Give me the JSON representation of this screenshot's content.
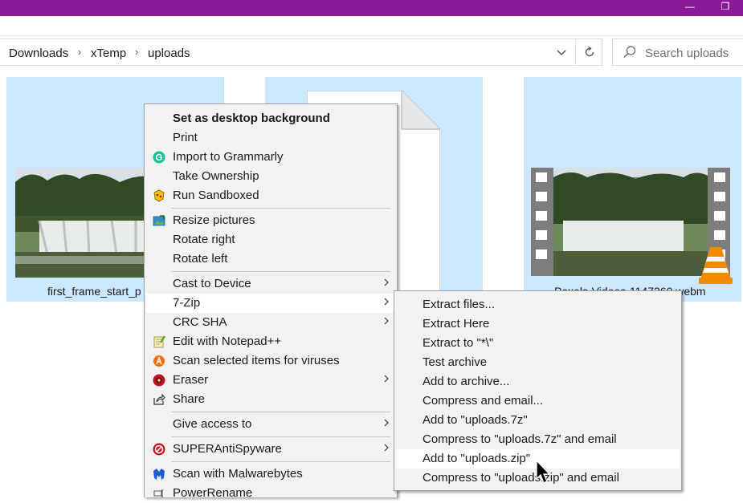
{
  "window": {
    "minimize_glyph": "—",
    "restore_glyph": "❐"
  },
  "address": {
    "crumbs": [
      "Downloads",
      "xTemp",
      "uploads"
    ],
    "separator": "›"
  },
  "search": {
    "placeholder": "Search uploads"
  },
  "files": [
    {
      "label": "first_frame_start_p"
    },
    {
      "label": ""
    },
    {
      "label": "Pexels-Videos-1147260.webm"
    }
  ],
  "context_menu": {
    "items": [
      {
        "label": "Set as desktop background",
        "icon": ""
      },
      {
        "label": "Print",
        "icon": ""
      },
      {
        "label": "Import to Grammarly",
        "icon": "grammarly-icon"
      },
      {
        "label": "Take Ownership",
        "icon": ""
      },
      {
        "label": "Run Sandboxed",
        "icon": "sandboxie-icon"
      },
      {
        "label": "Resize pictures",
        "icon": "resize-pictures-icon"
      },
      {
        "label": "Rotate right",
        "icon": ""
      },
      {
        "label": "Rotate left",
        "icon": ""
      },
      {
        "label": "Cast to Device",
        "icon": ""
      },
      {
        "label": "7-Zip",
        "icon": ""
      },
      {
        "label": "CRC SHA",
        "icon": ""
      },
      {
        "label": "Edit with Notepad++",
        "icon": "notepadpp-icon"
      },
      {
        "label": "Scan selected items for viruses",
        "icon": "avast-icon"
      },
      {
        "label": "Eraser",
        "icon": "eraser-icon"
      },
      {
        "label": "Share",
        "icon": "share-icon"
      },
      {
        "label": "Give access to",
        "icon": ""
      },
      {
        "label": "SUPERAntiSpyware",
        "icon": "superantispyware-icon"
      },
      {
        "label": "Scan with Malwarebytes",
        "icon": "malwarebytes-icon"
      },
      {
        "label": "PowerRename",
        "icon": "powerrename-icon"
      }
    ]
  },
  "submenu_7zip": {
    "items": [
      {
        "label": "Extract files..."
      },
      {
        "label": "Extract Here"
      },
      {
        "label": "Extract to \"*\\\""
      },
      {
        "label": "Test archive"
      },
      {
        "label": "Add to archive..."
      },
      {
        "label": "Compress and email..."
      },
      {
        "label": "Add to \"uploads.7z\""
      },
      {
        "label": "Compress to \"uploads.7z\" and email"
      },
      {
        "label": "Add to \"uploads.zip\""
      },
      {
        "label": "Compress to \"uploads.zip\" and email"
      }
    ]
  },
  "colors": {
    "title_bar": "#8a1a9a",
    "selection": "#cce8ff",
    "menu_bg": "#f2f2f2",
    "hover": "#ffffff"
  }
}
